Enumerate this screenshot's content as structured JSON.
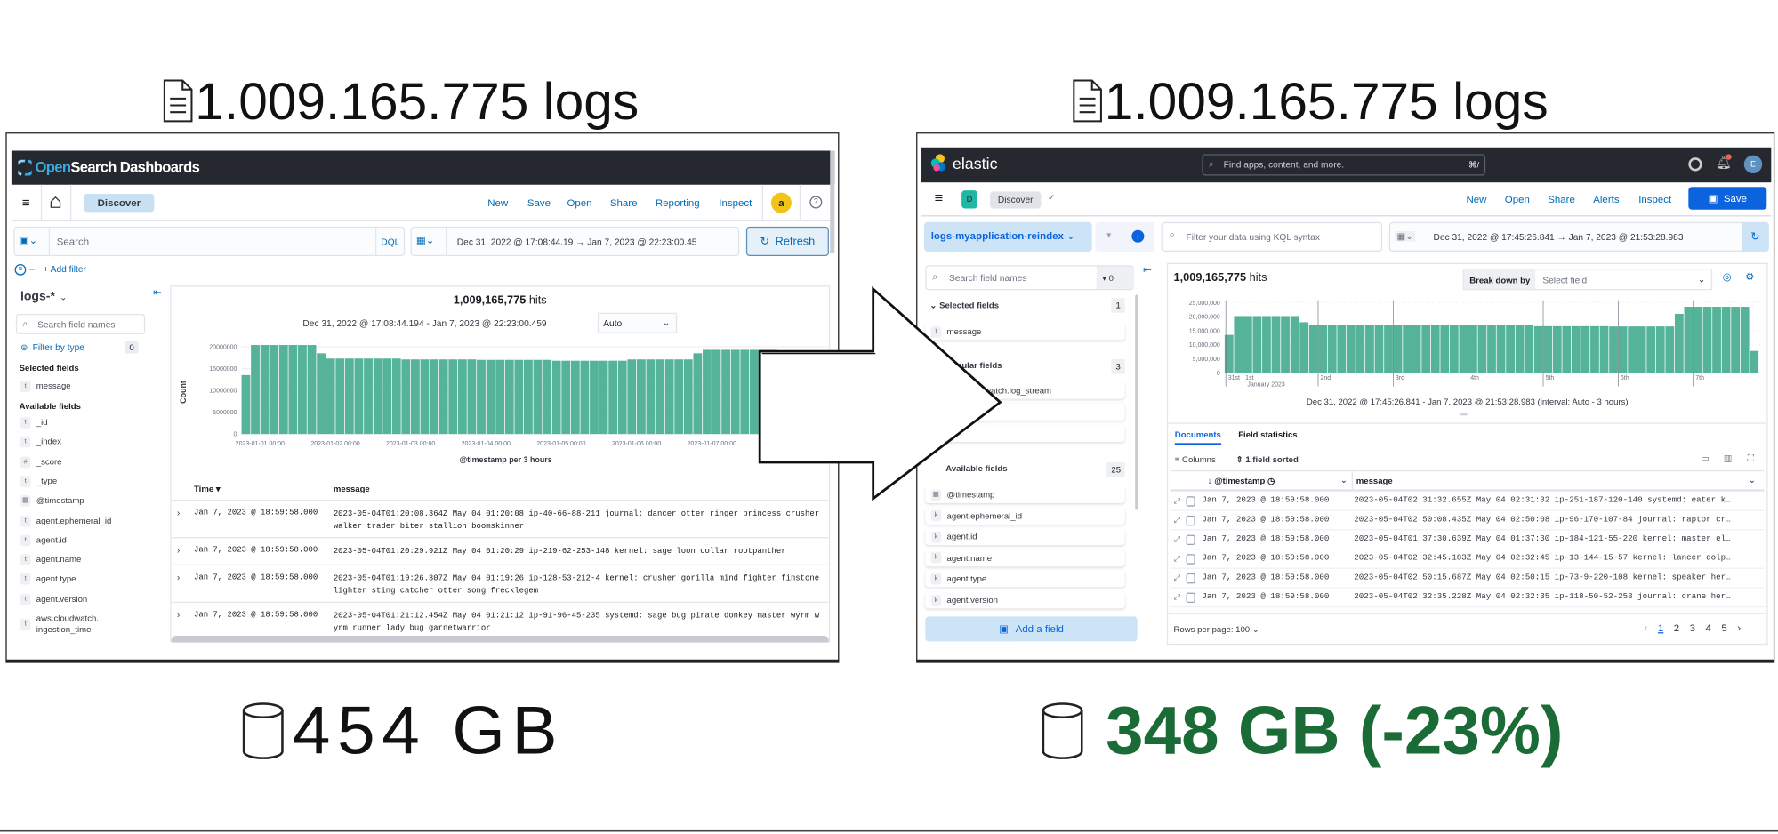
{
  "comparison": {
    "left_logs_caption": "1.009.165.775 logs",
    "right_logs_caption": "1.009.165.775 logs",
    "left_storage": "454 GB",
    "right_storage": "348 GB (-23%)",
    "right_storage_color": "#1b6b37"
  },
  "opensearch": {
    "logo_prefix": "Open",
    "logo_suffix": "Search Dashboards",
    "breadcrumb": "Discover",
    "nav_links": [
      "New",
      "Save",
      "Open",
      "Share",
      "Reporting",
      "Inspect"
    ],
    "avatar_initial": "a",
    "search_placeholder": "Search",
    "query_language": "DQL",
    "date_start": "Dec 31, 2022 @ 17:08:44.19",
    "date_arrow": "→",
    "date_end": "Jan 7, 2023 @ 22:23:00.45",
    "refresh_label": "Refresh",
    "add_filter": "+ Add filter",
    "index_pattern": "logs-*",
    "field_search_placeholder": "Search field names",
    "filter_by_type": "Filter by type",
    "filter_count": "0",
    "selected_fields_heading": "Selected fields",
    "selected_fields": [
      {
        "type": "t",
        "name": "message"
      }
    ],
    "available_fields_heading": "Available fields",
    "available_fields": [
      {
        "type": "t",
        "name": "_id"
      },
      {
        "type": "t",
        "name": "_index"
      },
      {
        "type": "#",
        "name": "_score"
      },
      {
        "type": "t",
        "name": "_type"
      },
      {
        "type": "cal",
        "name": "@timestamp"
      },
      {
        "type": "t",
        "name": "agent.ephemeral_id"
      },
      {
        "type": "t",
        "name": "agent.id"
      },
      {
        "type": "t",
        "name": "agent.name"
      },
      {
        "type": "t",
        "name": "agent.type"
      },
      {
        "type": "t",
        "name": "agent.version"
      },
      {
        "type": "t",
        "name": "aws.cloudwatch.\ningestion_time"
      }
    ],
    "hits_count": "1,009,165,775",
    "hits_label": "hits",
    "range_text": "Dec 31, 2022 @ 17:08:44.194 - Jan 7, 2023 @ 22:23:00.459",
    "interval_select": "Auto",
    "table_headers": [
      "Time",
      "message"
    ],
    "rows": [
      {
        "time": "Jan 7, 2023 @ 18:59:58.000",
        "message": "2023-05-04T01:20:08.364Z May 04 01:20:08 ip-40-66-88-211 journal: dancer otter ringer princess crusher walker trader biter stallion boomskinner"
      },
      {
        "time": "Jan 7, 2023 @ 18:59:58.000",
        "message": "2023-05-04T01:20:29.921Z May 04 01:20:29 ip-219-62-253-148 kernel: sage loon collar rootpanther"
      },
      {
        "time": "Jan 7, 2023 @ 18:59:58.000",
        "message": "2023-05-04T01:19:26.307Z May 04 01:19:26 ip-128-53-212-4 kernel: crusher gorilla mind fighter finstone lighter sting catcher otter song frecklegem"
      },
      {
        "time": "Jan 7, 2023 @ 18:59:58.000",
        "message": "2023-05-04T01:21:12.454Z May 04 01:21:12 ip-91-96-45-235 systemd: sage bug pirate donkey master wyrm wyrm runner lady bug garnetwarrior"
      }
    ]
  },
  "elastic": {
    "logo": "elastic",
    "search_placeholder": "Find apps, content, and more.",
    "search_shortcut": "⌘/",
    "avatar_initial": "E",
    "space_badge": "D",
    "breadcrumb": "Discover",
    "nav_links": [
      "New",
      "Open",
      "Share",
      "Alerts",
      "Inspect"
    ],
    "save_label": "Save",
    "data_view": "logs-myapplication-reindex",
    "kql_placeholder": "Filter your data using KQL syntax",
    "date_start": "Dec 31, 2022 @ 17:45:26.841",
    "date_arrow": "→",
    "date_end": "Jan 7, 2023 @ 21:53:28.983",
    "field_search_placeholder": "Search field names",
    "filter_count": "0",
    "selected_fields_heading": "Selected fields",
    "selected_count": "1",
    "selected_fields": [
      {
        "type": "t",
        "name": "message"
      }
    ],
    "popular_fields_heading": "Popular fields",
    "popular_count": "3",
    "popular_fields": [
      {
        "type": "k",
        "name": "aws.cloudwatch.log_stream"
      },
      {
        "type": "",
        "name": ""
      },
      {
        "type": "",
        "name": ""
      }
    ],
    "available_fields_heading": "Available fields",
    "available_count": "25",
    "available_fields": [
      {
        "type": "cal",
        "name": "@timestamp"
      },
      {
        "type": "k",
        "name": "agent.ephemeral_id"
      },
      {
        "type": "k",
        "name": "agent.id"
      },
      {
        "type": "k",
        "name": "agent.name"
      },
      {
        "type": "k",
        "name": "agent.type"
      },
      {
        "type": "k",
        "name": "agent.version"
      }
    ],
    "add_field_label": "Add a field",
    "hits_count": "1,009,165,775",
    "hits_label": "hits",
    "break_down_label": "Break down by",
    "break_down_placeholder": "Select field",
    "interval_text": "Dec 31, 2022 @ 17:45:26.841 - Jan 7, 2023 @ 21:53:28.983 (interval: Auto - 3 hours)",
    "tabs": [
      "Documents",
      "Field statistics"
    ],
    "active_tab": "Documents",
    "columns_label": "Columns",
    "sorted_label": "1 field sorted",
    "grid_headers": [
      "@timestamp",
      "message"
    ],
    "rows": [
      {
        "time": "Jan 7, 2023 @ 18:59:58.000",
        "message": "2023-05-04T02:31:32.655Z May 04 02:31:32 ip-251-187-120-140 systemd: eater k…"
      },
      {
        "time": "Jan 7, 2023 @ 18:59:58.000",
        "message": "2023-05-04T02:50:08.435Z May 04 02:50:08 ip-96-170-107-84 journal: raptor cr…"
      },
      {
        "time": "Jan 7, 2023 @ 18:59:58.000",
        "message": "2023-05-04T01:37:30.639Z May 04 01:37:30 ip-184-121-55-220 kernel: master el…"
      },
      {
        "time": "Jan 7, 2023 @ 18:59:58.000",
        "message": "2023-05-04T02:32:45.183Z May 04 02:32:45 ip-13-144-15-57 kernel: lancer dolp…"
      },
      {
        "time": "Jan 7, 2023 @ 18:59:58.000",
        "message": "2023-05-04T02:50:15.687Z May 04 02:50:15 ip-73-9-220-108 kernel: speaker her…"
      },
      {
        "time": "Jan 7, 2023 @ 18:59:58.000",
        "message": "2023-05-04T02:32:35.228Z May 04 02:32:35 ip-118-50-52-253 journal: crane her…"
      }
    ],
    "rows_per_page": "Rows per page: 100",
    "pages": [
      "1",
      "2",
      "3",
      "4",
      "5"
    ],
    "current_page": "1"
  },
  "chart_data": [
    {
      "type": "bar",
      "title": "",
      "xlabel": "@timestamp per 3 hours",
      "ylabel": "Count",
      "ylim": [
        0,
        20000000
      ],
      "yticks": [
        "0",
        "5000000",
        "10000000",
        "15000000",
        "20000000"
      ],
      "xticks": [
        "2023-01-01 00:00",
        "2023-01-02 00:00",
        "2023-01-03 00:00",
        "2023-01-04 00:00",
        "2023-01-05 00:00",
        "2023-01-06 00:00",
        "2023-01-07 00:00"
      ],
      "bar_color": "#54b399",
      "grid": true,
      "interval": "3 hours",
      "x_start": "2022-12-31 21:00",
      "values": [
        13500000,
        20400000,
        20400000,
        20400000,
        20400000,
        20400000,
        20400000,
        20400000,
        18500000,
        17300000,
        17300000,
        17300000,
        17300000,
        17300000,
        17300000,
        17300000,
        17300000,
        17100000,
        17100000,
        17100000,
        17100000,
        17100000,
        17100000,
        17100000,
        17100000,
        17000000,
        17000000,
        17000000,
        17000000,
        17000000,
        17000000,
        17000000,
        17000000,
        16800000,
        16800000,
        16800000,
        16800000,
        16800000,
        16800000,
        16800000,
        16800000,
        17100000,
        17100000,
        17100000,
        17100000,
        17100000,
        17100000,
        17100000,
        18500000,
        19300000,
        19300000,
        19300000,
        19300000,
        19300000,
        19300000,
        19300000,
        19300000
      ]
    },
    {
      "type": "bar",
      "title": "",
      "xlabel": "",
      "ylabel": "",
      "ylim": [
        0,
        25000000
      ],
      "yticks": [
        "0",
        "5,000,000",
        "10,000,000",
        "15,000,000",
        "20,000,000",
        "25,000,000"
      ],
      "xticks": [
        "31st",
        "1st",
        "2nd",
        "3rd",
        "4th",
        "5th",
        "6th",
        "7th"
      ],
      "xtick_sublabel": "January 2023",
      "bar_color": "#54b399",
      "grid": true,
      "interval": "3 hours",
      "x_start": "2022-12-31 21:00",
      "values": [
        13500000,
        20200000,
        20200000,
        20200000,
        20200000,
        20200000,
        20200000,
        20200000,
        18000000,
        17000000,
        17000000,
        17000000,
        17000000,
        17000000,
        17000000,
        17000000,
        17000000,
        17000000,
        17000000,
        17000000,
        17000000,
        17000000,
        17000000,
        17000000,
        17000000,
        16900000,
        16900000,
        16900000,
        16900000,
        16900000,
        16900000,
        16900000,
        16900000,
        16600000,
        16600000,
        16600000,
        16600000,
        16600000,
        16600000,
        16600000,
        16600000,
        16500000,
        16500000,
        16500000,
        16500000,
        16500000,
        16500000,
        16500000,
        21000000,
        23500000,
        23500000,
        23500000,
        23500000,
        23500000,
        23500000,
        23500000,
        7800000
      ]
    }
  ]
}
